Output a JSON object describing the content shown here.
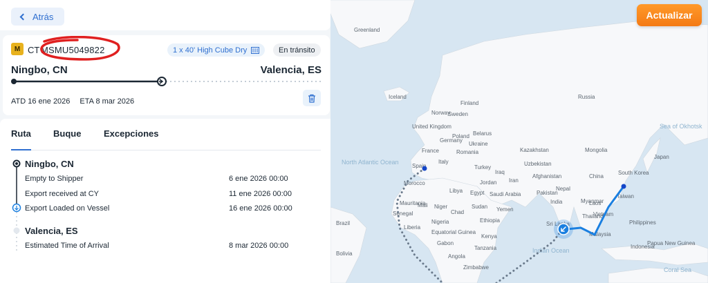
{
  "header": {
    "back_label": "Atrás",
    "refresh_label": "Actualizar"
  },
  "shipment": {
    "carrier_logo_text": "M",
    "prefix": "CT",
    "container_id": "MSMU5049822",
    "container_type": "1 x 40' High Cube Dry",
    "status": "En tránsito",
    "origin": "Ningbo, CN",
    "destination": "Valencia, ES",
    "atd": "ATD 16 ene 2026",
    "eta": "ETA 8 mar 2026",
    "progress_fraction": 0.5
  },
  "tabs": [
    {
      "label": "Ruta",
      "active": true
    },
    {
      "label": "Buque",
      "active": false
    },
    {
      "label": "Excepciones",
      "active": false
    }
  ],
  "route": {
    "stops": [
      {
        "name": "Ningbo, CN",
        "events": [
          {
            "label": "Empty to Shipper",
            "date": "6 ene 2026 00:00"
          },
          {
            "label": "Export received at CY",
            "date": "11 ene 2026 00:00"
          },
          {
            "label": "Export Loaded on Vessel",
            "date": "16 ene 2026 00:00"
          }
        ]
      },
      {
        "name": "Valencia, ES",
        "events": [
          {
            "label": "Estimated Time of Arrival",
            "date": "8 mar 2026 00:00"
          }
        ]
      }
    ]
  },
  "map": {
    "countries": [
      "Greenland",
      "Iceland",
      "Finland",
      "Norway",
      "Sweden",
      "Russia",
      "United Kingdom",
      "Belarus",
      "Poland",
      "Germany",
      "Ukraine",
      "France",
      "Romania",
      "Kazakhstan",
      "Mongolia",
      "Spain",
      "Italy",
      "Turkey",
      "Uzbekistan",
      "Morocco",
      "Libya",
      "Egypt",
      "Jordan",
      "Iraq",
      "Iran",
      "Afghanistan",
      "Pakistan",
      "China",
      "Japan",
      "South Korea",
      "Taiwan",
      "Saudi Arabia",
      "Nepal",
      "India",
      "Myanmar",
      "Laos",
      "Vietnam",
      "Thailand",
      "Malaysia",
      "Mauritania",
      "Mali",
      "Niger",
      "Chad",
      "Sudan",
      "Senegal",
      "Yemen",
      "Ethiopia",
      "Nigeria",
      "Sri Lanka",
      "Liberia",
      "Kenya",
      "Equatorial Guinea",
      "Gabon",
      "Tanzania",
      "Angola",
      "Zimbabwe",
      "Brazil",
      "Bolivia",
      "Indonesia",
      "Papua New Guinea",
      "Philippines"
    ],
    "oceans": [
      "North Atlantic Ocean",
      "Sea of Okhotsk",
      "Indian Ocean",
      "Coral Sea"
    ],
    "colors": {
      "route_active": "#1a7fe0",
      "route_planned": "#6a7a8c",
      "land": "#f7f8fa",
      "water": "#d7e6f2"
    }
  }
}
